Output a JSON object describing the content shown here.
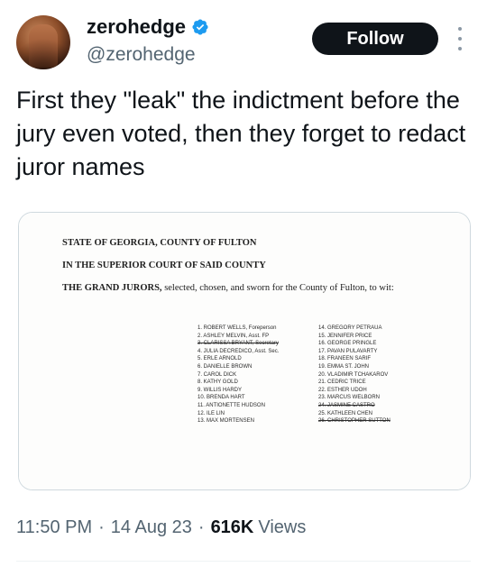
{
  "header": {
    "display_name": "zerohedge",
    "handle": "@zerohedge",
    "follow_label": "Follow",
    "avatar_icon": "avatar-photo",
    "verified_icon": "verified-badge-icon",
    "verified_color": "#1d9bf0",
    "more_icon": "more-options-icon"
  },
  "tweet": {
    "text": "First they \"leak\" the indictment before the jury even voted, then they forget to redact juror names"
  },
  "document": {
    "line1": "STATE OF GEORGIA, COUNTY OF FULTON",
    "line2": "IN THE SUPERIOR COURT OF SAID COUNTY",
    "line3_bold": "THE GRAND JURORS,",
    "line3_rest": " selected, chosen, and sworn for the County of Fulton, to wit:",
    "jurors_left": [
      "1. ROBERT WELLS, Foreperson",
      "2. ASHLEY MELVIN, Asst. FP",
      "3. CLARISSA BRYANT, Secretary",
      "4. JULIA DECREDICO, Asst. Sec.",
      "5. ERLE ARNOLD",
      "6. DANIELLE BROWN",
      "7. CAROL DICK",
      "8. KATHY GOLD",
      "9. WILLIS HARDY",
      "10. BRENDA HART",
      "11. ANTIONETTE HUDSON",
      "12. ILE LIN",
      "13. MAX MORTENSEN"
    ],
    "jurors_right": [
      "14. GREGORY PETRAUA",
      "15. JENNIFER PRICE",
      "16. GEORGE PRINGLE",
      "17. PAVAN PULAVARTY",
      "18. FRANEEN SARIF",
      "19. EMMA ST. JOHN",
      "20. VLADIMIR TCHAKAROV",
      "21. CEDRIC TRICE",
      "22. ESTHER UDOH",
      "23. MARCUS WELBORN",
      "24. JASMINE CASTRO",
      "25. KATHLEEN CHEN",
      "26. CHRISTOPHER SUTTON"
    ]
  },
  "meta": {
    "time": "11:50 PM",
    "sep1": "·",
    "date": "14 Aug 23",
    "sep2": "·",
    "views_count": "616K",
    "views_label": "Views"
  }
}
